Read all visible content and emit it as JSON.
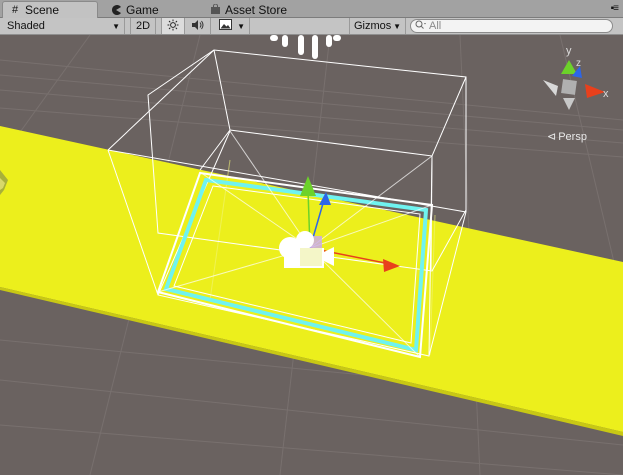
{
  "tabs": [
    {
      "label": "Scene",
      "icon": "scene-hash-icon",
      "active": true
    },
    {
      "label": "Game",
      "icon": "pacman-game-icon",
      "active": false
    },
    {
      "label": "Asset Store",
      "icon": "store-bag-icon",
      "active": false
    }
  ],
  "toolbar": {
    "draw_mode": "Shaded",
    "two_d_label": "2D",
    "lighting_icon": "sun-icon",
    "audio_icon": "speaker-icon",
    "effects_icon": "image-icon",
    "gizmos_label": "Gizmos",
    "search_placeholder": "All"
  },
  "orientation_gizmo": {
    "axis_y": "y",
    "axis_z": "z",
    "axis_x": "x",
    "projection_label": "Persp"
  },
  "colors": {
    "ground": "#ecef1c",
    "background": "#6a6260",
    "trigger_outline": "#6ff3f0",
    "axis_x": "#e8401c",
    "axis_y": "#6cd22a",
    "axis_z": "#2c66e8"
  }
}
